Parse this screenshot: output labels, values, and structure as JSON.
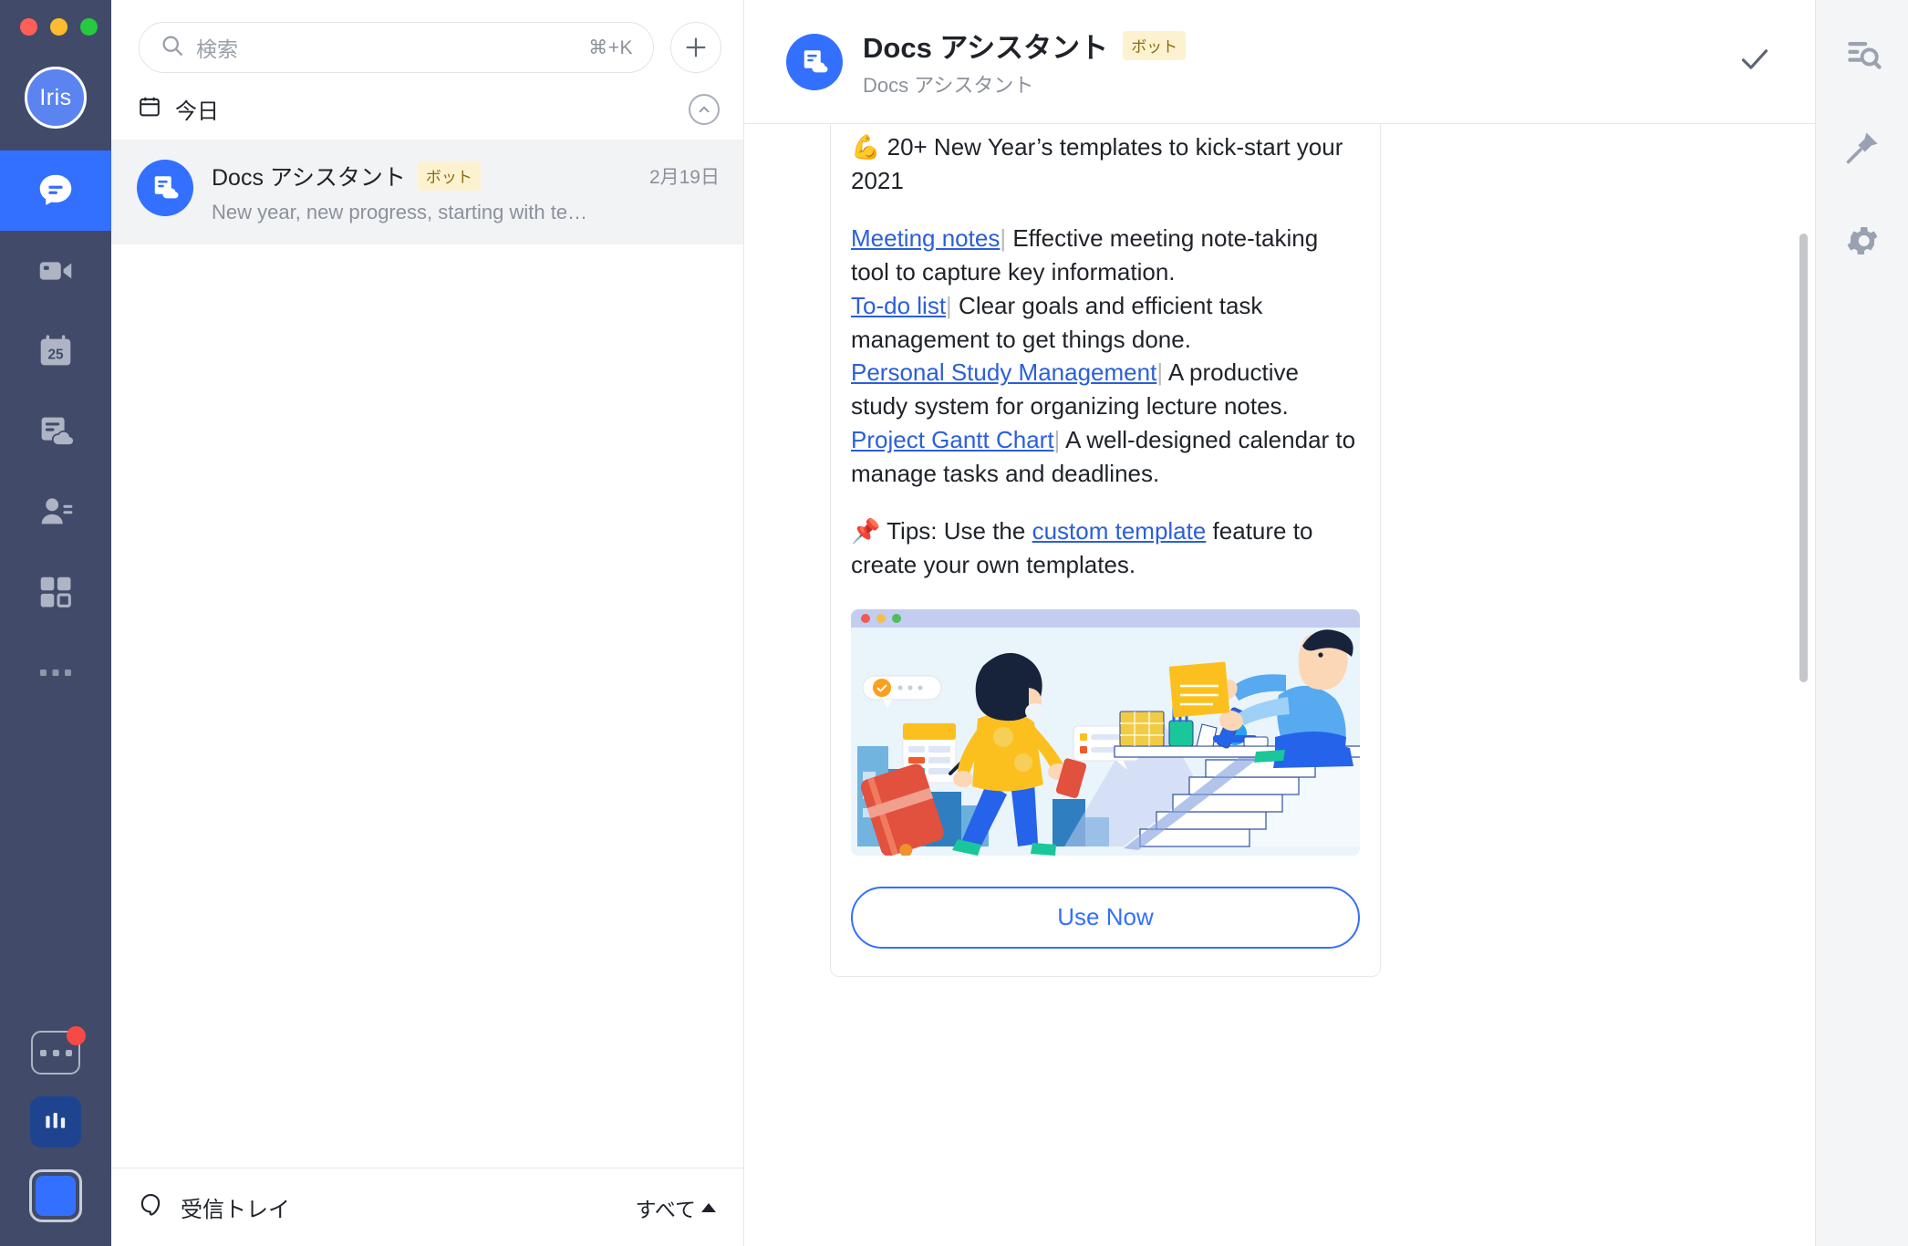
{
  "window": {
    "traffic_lights": [
      "close",
      "minimize",
      "maximize"
    ]
  },
  "left_rail": {
    "avatar_initials": "Iris",
    "items": [
      {
        "icon": "chat-icon",
        "name": "chat",
        "active": true
      },
      {
        "icon": "video-icon",
        "name": "video",
        "active": false
      },
      {
        "icon": "calendar-icon",
        "name": "calendar",
        "active": false,
        "day": "25"
      },
      {
        "icon": "docs-cloud-icon",
        "name": "docs",
        "active": false
      },
      {
        "icon": "contacts-icon",
        "name": "contacts",
        "active": false
      },
      {
        "icon": "apps-grid-icon",
        "name": "workplace",
        "active": false
      },
      {
        "icon": "more-dots-icon",
        "name": "more",
        "active": false
      }
    ],
    "bottom": [
      {
        "icon": "more-apps-icon",
        "name": "more-apps",
        "badge": true
      },
      {
        "icon": "analytics-app-icon",
        "name": "analytics-app"
      },
      {
        "icon": "selected-app-icon",
        "name": "selected-app"
      }
    ]
  },
  "search": {
    "placeholder": "検索",
    "shortcut": "⌘+K",
    "add_label": "+"
  },
  "list": {
    "section_label": "今日",
    "conversations": [
      {
        "name": "Docs アシスタント",
        "badge": "ボット",
        "date": "2月19日",
        "snippet": "New year, new progress, starting with te…"
      }
    ],
    "footer": {
      "inbox_label": "受信トレイ",
      "filter_label": "すべて"
    }
  },
  "chat_header": {
    "title": "Docs アシスタント",
    "badge": "ボット",
    "subtitle": "Docs アシスタント",
    "action_icon": "check-icon"
  },
  "message": {
    "headline_emoji": "💪",
    "headline": "20+ New Year’s templates to kick-start your 2021",
    "items": [
      {
        "link": "Meeting notes",
        "sep": "|",
        "desc": "Effective meeting note-taking tool to capture key information."
      },
      {
        "link": "To-do list",
        "sep": "|",
        "desc": "Clear goals and efficient task management to get things done."
      },
      {
        "link": "Personal Study Management",
        "sep": "|",
        "desc": "A productive study system for organizing lecture notes."
      },
      {
        "link": "Project Gantt Chart",
        "sep": "|",
        "desc": "A well-designed calendar to manage tasks and deadlines."
      }
    ],
    "tips_emoji": "📌",
    "tips_prefix": "Tips: Use the ",
    "tips_link": "custom template",
    "tips_suffix": " feature to create your own templates.",
    "cta_label": "Use Now"
  },
  "right_rail": {
    "items": [
      {
        "icon": "search-in-chat-icon",
        "name": "search-in-chat"
      },
      {
        "icon": "pin-icon",
        "name": "pinned"
      },
      {
        "icon": "gear-icon",
        "name": "settings"
      }
    ]
  },
  "colors": {
    "brand_blue": "#3370ff",
    "rail_bg": "#414b69",
    "link_blue": "#2b5fd9",
    "badge_bg": "#fdf2d0",
    "badge_text": "#8a6a12",
    "selected_row": "#f2f3f5"
  }
}
